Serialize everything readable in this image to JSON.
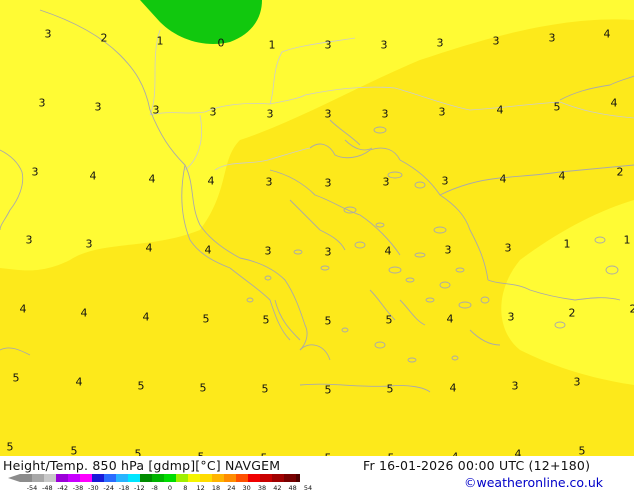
{
  "map": {
    "colors": {
      "bg": "#fde91b",
      "light": "#fffb34",
      "green": "#11c80e",
      "coast": "#aaaaaa",
      "border": "#cccccc"
    },
    "labels": [
      {
        "text": "3"
      },
      {
        "text": "2"
      },
      {
        "text": "1"
      },
      {
        "text": "0"
      },
      {
        "text": "1"
      },
      {
        "text": "3"
      },
      {
        "text": "3"
      },
      {
        "text": "3"
      },
      {
        "text": "3"
      },
      {
        "text": "3"
      },
      {
        "text": "4"
      },
      {
        "text": "3"
      },
      {
        "text": "3"
      },
      {
        "text": "3"
      },
      {
        "text": "3"
      },
      {
        "text": "3"
      },
      {
        "text": "3"
      },
      {
        "text": "3"
      },
      {
        "text": "3"
      },
      {
        "text": "4"
      },
      {
        "text": "5"
      },
      {
        "text": "4"
      },
      {
        "text": "3"
      },
      {
        "text": "4"
      },
      {
        "text": "4"
      },
      {
        "text": "4"
      },
      {
        "text": "3"
      },
      {
        "text": "3"
      },
      {
        "text": "3"
      },
      {
        "text": "3"
      },
      {
        "text": "4"
      },
      {
        "text": "4"
      },
      {
        "text": "2"
      },
      {
        "text": "3"
      },
      {
        "text": "3"
      },
      {
        "text": "4"
      },
      {
        "text": "4"
      },
      {
        "text": "3"
      },
      {
        "text": "3"
      },
      {
        "text": "4"
      },
      {
        "text": "3"
      },
      {
        "text": "3"
      },
      {
        "text": "1"
      },
      {
        "text": "1"
      },
      {
        "text": "4"
      },
      {
        "text": "4"
      },
      {
        "text": "4"
      },
      {
        "text": "5"
      },
      {
        "text": "5"
      },
      {
        "text": "5"
      },
      {
        "text": "5"
      },
      {
        "text": "4"
      },
      {
        "text": "3"
      },
      {
        "text": "2"
      },
      {
        "text": "2"
      },
      {
        "text": "5"
      },
      {
        "text": "4"
      },
      {
        "text": "5"
      },
      {
        "text": "5"
      },
      {
        "text": "5"
      },
      {
        "text": "5"
      },
      {
        "text": "5"
      },
      {
        "text": "4"
      },
      {
        "text": "3"
      },
      {
        "text": "3"
      },
      {
        "text": "5"
      },
      {
        "text": "5"
      },
      {
        "text": "5"
      },
      {
        "text": "5"
      },
      {
        "text": "5"
      },
      {
        "text": "5"
      },
      {
        "text": "5"
      },
      {
        "text": "4"
      },
      {
        "text": "4"
      },
      {
        "text": "5"
      }
    ]
  },
  "footer": {
    "title": "Height/Temp. 850 hPa [gdmp][°C] NAVGEM",
    "datetime": "Fr 16-01-2026 00:00 UTC (12+180)",
    "credit": "©weatheronline.co.uk"
  },
  "legend": {
    "colors": [
      "#8c8c8c",
      "#a8a8a8",
      "#c8c8c8",
      "#9b00d8",
      "#c800ff",
      "#ff00ff",
      "#1a1ad8",
      "#2a6cff",
      "#28b4ff",
      "#00e6ff",
      "#008c00",
      "#00b400",
      "#00dc00",
      "#a0f000",
      "#f5f500",
      "#ffdc00",
      "#ffb400",
      "#ff8c00",
      "#ff5000",
      "#f00000",
      "#c80000",
      "#a00000",
      "#780000",
      "#500000"
    ],
    "ticks": [
      "-54",
      "-48",
      "-42",
      "-38",
      "-30",
      "-24",
      "-18",
      "-12",
      "-8",
      "0",
      "8",
      "12",
      "18",
      "24",
      "30",
      "38",
      "42",
      "48",
      "54"
    ]
  }
}
